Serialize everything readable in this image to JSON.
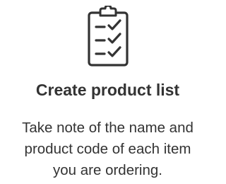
{
  "card": {
    "icon": "clipboard-checklist-icon",
    "title": "Create product list",
    "description_lines": [
      "Take note of the name and",
      "product code of each item",
      "you are ordering."
    ]
  },
  "colors": {
    "text": "#333333",
    "icon": "#333333",
    "background": "#ffffff"
  }
}
